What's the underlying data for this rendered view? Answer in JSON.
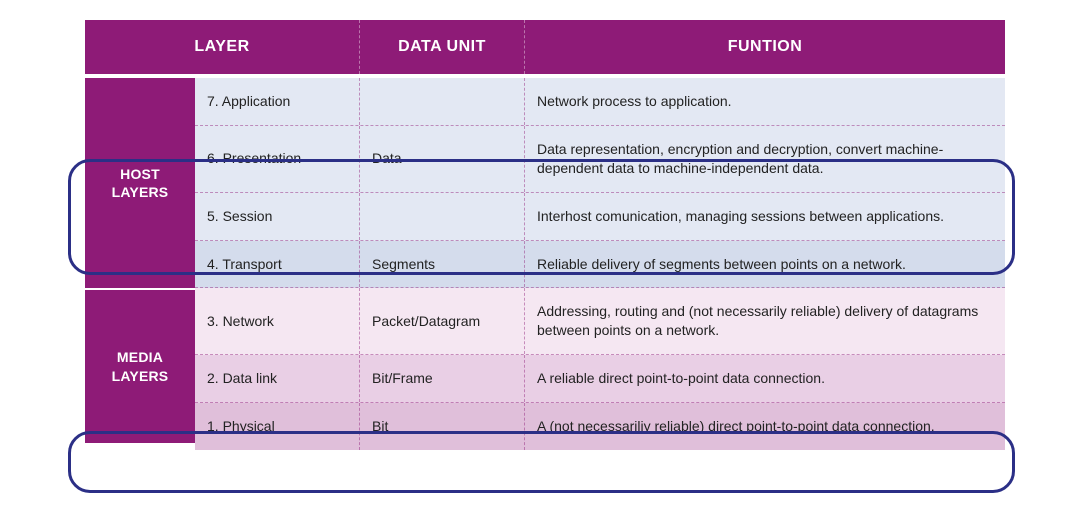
{
  "header": {
    "layer": "LAYER",
    "data_unit": "DATA UNIT",
    "function": "FUNTION"
  },
  "groups": {
    "host": "HOST LAYERS",
    "media": "MEDIA LAYERS"
  },
  "rows": [
    {
      "layer": "7. Application",
      "data_unit": "",
      "func": "Network process to application."
    },
    {
      "layer": "6. Presentation",
      "data_unit": "Data",
      "func": "Data representation, encryption and decryption, convert machine-dependent data to machine-independent data."
    },
    {
      "layer": "5. Session",
      "data_unit": "",
      "func": "Interhost comunication, managing sessions between applications."
    },
    {
      "layer": "4. Transport",
      "data_unit": "Segments",
      "func": "Reliable delivery of segments between points on a network."
    },
    {
      "layer": "3. Network",
      "data_unit": "Packet/Datagram",
      "func": "Addressing, routing and (not necessarily reliable) delivery of datagrams between points on a network."
    },
    {
      "layer": "2. Data link",
      "data_unit": "Bit/Frame",
      "func": "A reliable direct point-to-point data connection."
    },
    {
      "layer": "1. Physical",
      "data_unit": "Bit",
      "func": "A (not necessariliy reliable) direct point-to-point data connection."
    }
  ]
}
